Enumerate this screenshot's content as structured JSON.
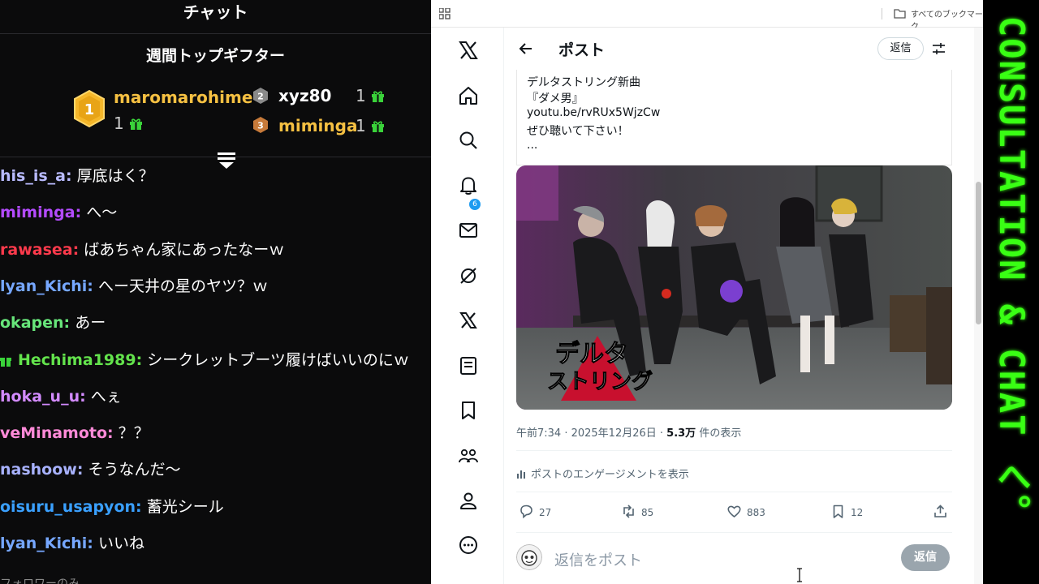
{
  "chat": {
    "title": "チャット",
    "gifters_title": "週間トップギフター",
    "gifters": [
      {
        "rank": "1",
        "name": "maromarohime",
        "count": "1"
      },
      {
        "rank": "2",
        "name": "xyz80",
        "count": "1"
      },
      {
        "rank": "3",
        "name": "miminga",
        "count": "1"
      }
    ],
    "messages": [
      {
        "user": "his_is_a",
        "sep": ":",
        "text": "厚底はく？",
        "color": "#b9bbff"
      },
      {
        "user": "miminga",
        "sep": ":",
        "text": "へ〜",
        "color": "#b44bff"
      },
      {
        "user": "rawasea",
        "sep": ":",
        "text": "ばあちゃん家にあったなーｗ",
        "color": "#ff3a4c"
      },
      {
        "user": "lyan_Kichi",
        "sep": ":",
        "text": "へー天井の星のヤツ？ｗ",
        "color": "#76a7ff"
      },
      {
        "user": "okapen",
        "sep": ":",
        "text": "あー",
        "color": "#67e57a"
      },
      {
        "user": "Hechima1989",
        "sep": ":",
        "text": "シークレットブーツ履けばいいのにｗ",
        "color": "#63e34c",
        "gift": true
      },
      {
        "user": "hoka_u_u",
        "sep": ":",
        "text": "へぇ",
        "color": "#d38bff"
      },
      {
        "user": "veMinamoto",
        "sep": ":",
        "text": "？？",
        "color": "#ff8ad8"
      },
      {
        "user": "nashoow",
        "sep": ":",
        "text": "そうなんだ〜",
        "color": "#a8b2ff"
      },
      {
        "user": "oisuru_usapyon",
        "sep": ":",
        "text": "蓄光シール",
        "color": "#3aa0ff"
      },
      {
        "user": "lyan_Kichi",
        "sep": ":",
        "text": "いいね",
        "color": "#76a7ff"
      }
    ],
    "footer_note": "フォロワーのみ"
  },
  "browser": {
    "bookmarks_label": "すべてのブックマーク"
  },
  "x": {
    "notification_count": "6",
    "header_title": "ポスト",
    "reply_pill": "返信",
    "tweet_lines": [
      "デルタストリング新曲",
      "『ダメ男』",
      "youtu.be/rvRUx5WjzCw",
      "ぜひ聴いて下さい！",
      "..."
    ],
    "image_logo_text": [
      "デルタ",
      "ストリング"
    ],
    "meta_time": "午前7:34 · 2025年12月26日 · ",
    "meta_views": "5.3万",
    "meta_views_suffix": " 件の表示",
    "engagement_label": "ポストのエンゲージメントを表示",
    "actions": {
      "replies": "27",
      "reposts": "85",
      "likes": "883",
      "bookmarks": "12"
    },
    "reply_placeholder": "返信をポスト",
    "reply_button": "返信"
  },
  "banner": {
    "text": "CONSULTATION & CHAT へ。"
  },
  "colors": {
    "gold": "#f5c042",
    "banner_green": "#39ff14",
    "x_blue": "#1d9bf0"
  }
}
